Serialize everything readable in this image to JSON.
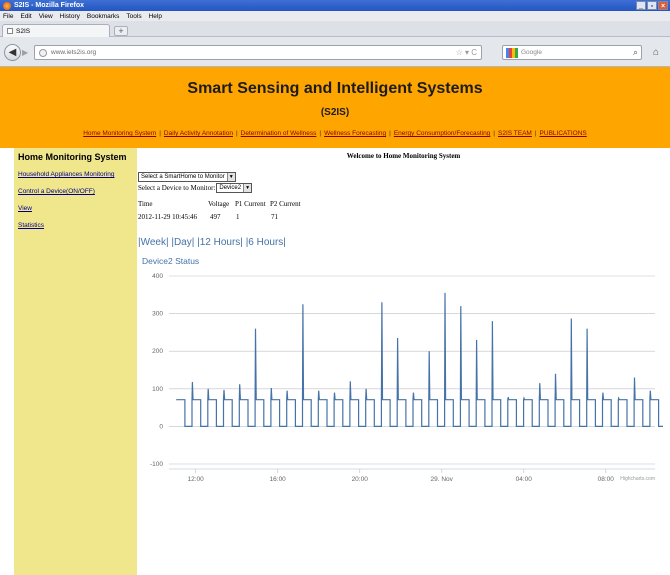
{
  "browser": {
    "window_title": "S2IS - Mozilla Firefox",
    "menu": [
      "File",
      "Edit",
      "View",
      "History",
      "Bookmarks",
      "Tools",
      "Help"
    ],
    "tab_label": "S2IS",
    "url": "www.iets2is.org",
    "search_placeholder": "Google"
  },
  "page": {
    "title": "Smart Sensing and Intelligent Systems",
    "abbr": "(S2IS)",
    "nav": [
      "Home Monitoring System",
      "Daily Activity Annotation",
      "Determination of Wellness",
      "Wellness Forecasting",
      "Energy Consumption/Forecasting",
      "S2IS TEAM",
      "PUBLICATIONS"
    ]
  },
  "sidebar": {
    "title": "Home Monitoring System",
    "links": [
      "Household Appliances Monitoring",
      "Control a Device(ON/OFF)",
      "View",
      "Statistics"
    ]
  },
  "main": {
    "welcome": "Welcome to Home Monitoring System",
    "smarthome_select": "Select a SmartHome to Monitor",
    "device_label": "Select a Device to Monitor:",
    "device_select": "Device2",
    "readings_headers": [
      "Time",
      "Voltage",
      "P1 Current",
      "P2 Current"
    ],
    "readings_values": [
      "2012-11-29 10:45:46",
      "497",
      "1",
      "71"
    ],
    "ranges": [
      "|Week|",
      "|Day|",
      "|12 Hours|",
      "|6 Hours|"
    ]
  },
  "colors": {
    "banner": "#ffa500",
    "sidebar": "#f0e68c",
    "series": "#4572a7",
    "link": "#8b0000"
  },
  "chart_data": {
    "type": "line",
    "title": "Device2 Status",
    "ylim": [
      -100,
      400
    ],
    "yticks": [
      -100,
      0,
      100,
      200,
      300,
      400
    ],
    "xlim": [
      10.7,
      34.4
    ],
    "xticks": [
      {
        "value": 12,
        "label": "12:00"
      },
      {
        "value": 16,
        "label": "16:00"
      },
      {
        "value": 20,
        "label": "20:00"
      },
      {
        "value": 24,
        "label": "29. Nov"
      },
      {
        "value": 28,
        "label": "04:00"
      },
      {
        "value": 32,
        "label": "08:00"
      }
    ],
    "series": [
      {
        "pattern": {
          "start": 11.05,
          "period": 0.77,
          "cycles": 31,
          "on_level": 71,
          "off_level": 0,
          "on_fraction": 0.55
        },
        "peaks": [
          {
            "cycle": 0,
            "value": 71
          },
          {
            "cycle": 1,
            "value": 118
          },
          {
            "cycle": 2,
            "value": 100
          },
          {
            "cycle": 3,
            "value": 97
          },
          {
            "cycle": 4,
            "value": 112
          },
          {
            "cycle": 5,
            "value": 260
          },
          {
            "cycle": 6,
            "value": 102
          },
          {
            "cycle": 7,
            "value": 95
          },
          {
            "cycle": 8,
            "value": 325
          },
          {
            "cycle": 9,
            "value": 95
          },
          {
            "cycle": 10,
            "value": 90
          },
          {
            "cycle": 11,
            "value": 120
          },
          {
            "cycle": 12,
            "value": 100
          },
          {
            "cycle": 13,
            "value": 330
          },
          {
            "cycle": 14,
            "value": 235
          },
          {
            "cycle": 15,
            "value": 90
          },
          {
            "cycle": 16,
            "value": 200
          },
          {
            "cycle": 17,
            "value": 355
          },
          {
            "cycle": 18,
            "value": 320
          },
          {
            "cycle": 19,
            "value": 230
          },
          {
            "cycle": 20,
            "value": 280
          },
          {
            "cycle": 21,
            "value": 78
          },
          {
            "cycle": 22,
            "value": 75
          },
          {
            "cycle": 23,
            "value": 115
          },
          {
            "cycle": 24,
            "value": 140
          },
          {
            "cycle": 25,
            "value": 287
          },
          {
            "cycle": 26,
            "value": 260
          },
          {
            "cycle": 27,
            "value": 90
          },
          {
            "cycle": 28,
            "value": 75
          },
          {
            "cycle": 29,
            "value": 130
          },
          {
            "cycle": 30,
            "value": 95
          }
        ]
      }
    ],
    "grid": true,
    "legend": false,
    "credits": "Highcharts.com"
  }
}
